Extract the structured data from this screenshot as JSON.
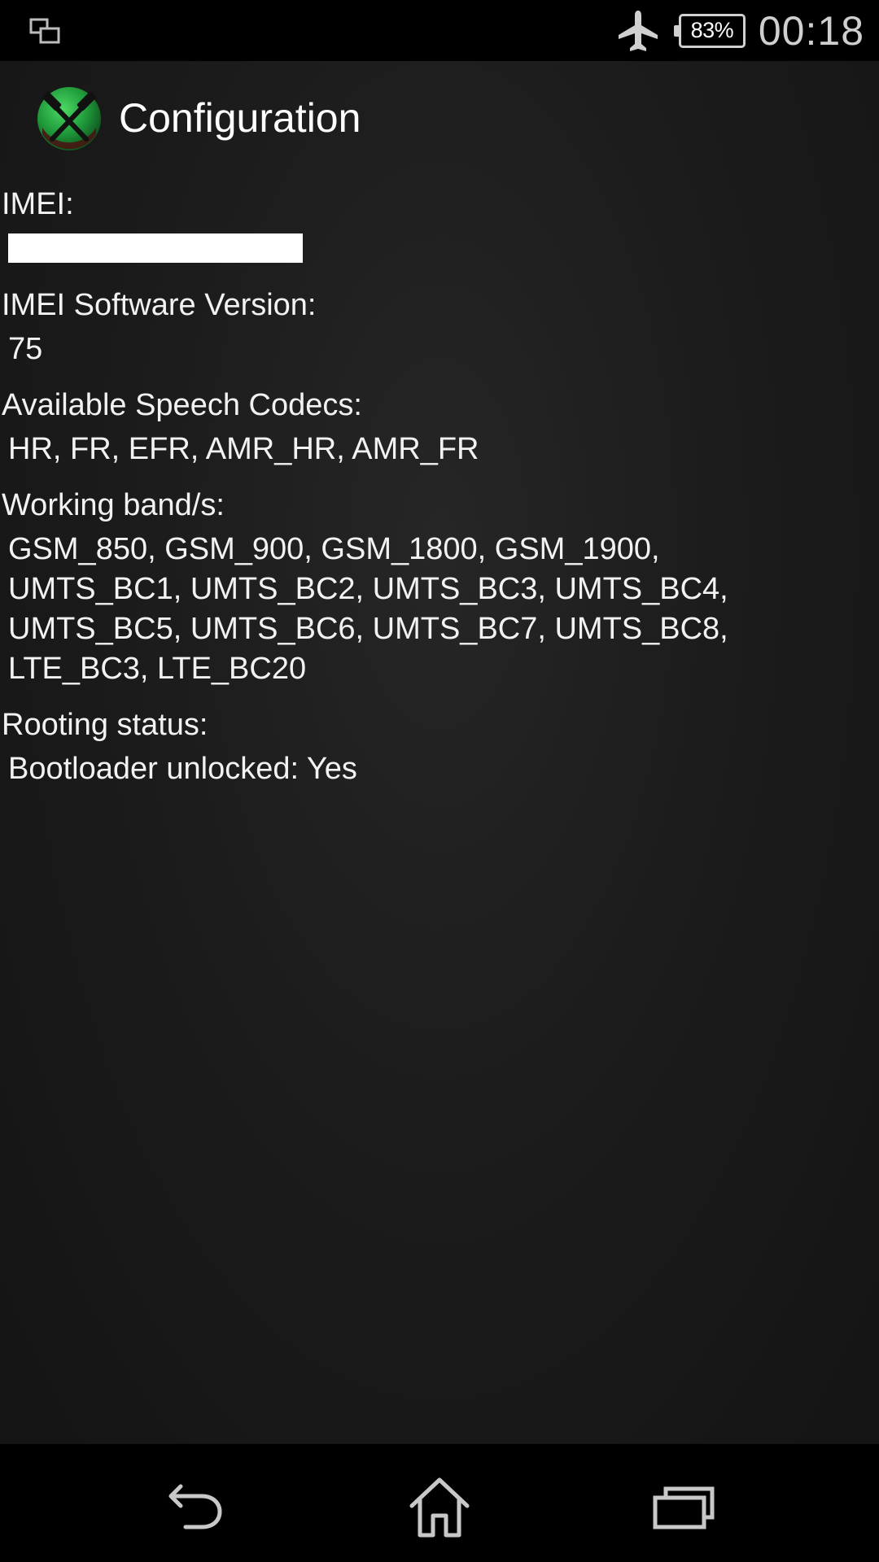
{
  "status_bar": {
    "left_icon": "screenshot-icon",
    "airplane_icon": "airplane-icon",
    "battery_percent": "83%",
    "time": "00:18"
  },
  "action_bar": {
    "app_icon": "crossed-hammers-icon",
    "title": "Configuration"
  },
  "info": {
    "imei": {
      "label": "IMEI:"
    },
    "imei_sv": {
      "label": "IMEI Software Version:",
      "value": "75"
    },
    "codecs": {
      "label": "Available Speech Codecs:",
      "value": "HR, FR, EFR, AMR_HR, AMR_FR"
    },
    "bands": {
      "label": "Working band/s:",
      "value": "GSM_850, GSM_900, GSM_1800, GSM_1900,\nUMTS_BC1, UMTS_BC2, UMTS_BC3, UMTS_BC4,\nUMTS_BC5, UMTS_BC6, UMTS_BC7, UMTS_BC8,\nLTE_BC3, LTE_BC20"
    },
    "rooting": {
      "label": "Rooting status:",
      "value": "Bootloader unlocked: Yes"
    }
  },
  "nav_bar": {
    "back_icon": "back-icon",
    "home_icon": "home-icon",
    "recents_icon": "recents-icon"
  },
  "colors": {
    "background": "#1c1c1c",
    "text": "#f2f2f2",
    "icon_green": "#2ea84a"
  }
}
